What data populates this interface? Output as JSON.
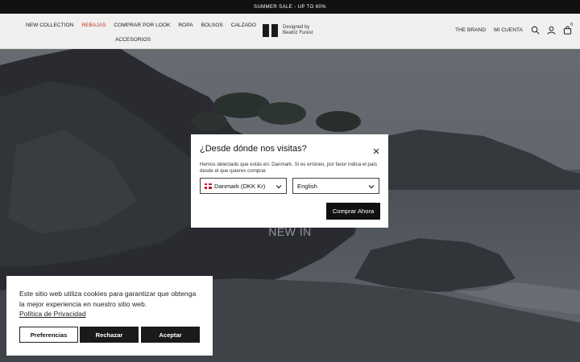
{
  "announcement": "SUMMER SALE - UP TO 60%",
  "nav_left": {
    "row1": [
      "NEW COLLECTION",
      "REBAJAS",
      "COMPRAR POR LOOK",
      "ROPA",
      "BOLSOS",
      "CALZADO"
    ],
    "row2": "ACCESORIOS"
  },
  "logo": {
    "line1": "Designed by",
    "line2": "Beatriz Furest"
  },
  "nav_right": {
    "brand": "THE BRAND",
    "account": "MI CUENTA"
  },
  "cart_count": "0",
  "hero": {
    "title": "NEW IN"
  },
  "country_modal": {
    "title": "¿Desde dónde nos visitas?",
    "text": "Hemos detectado que estás en: Danmark. Si es erróneo, por favor indica el país desde el que quieres comprar.",
    "country_value": "Danmark (DKK Kr)",
    "language_value": "English",
    "submit_label": "Comprar Ahora"
  },
  "cookie_banner": {
    "text": "Este sitio web utiliza cookies para garantizar que obtenga la mejor experiencia en nuestro sitio web.",
    "link": "Política de Privacidad",
    "preferences_label": "Preferencias",
    "reject_label": "Rechazar",
    "accept_label": "Aceptar"
  },
  "colors": {
    "sale": "#c0392b",
    "header_bg": "#f1f0ee",
    "button_dark": "#1a1a1a"
  },
  "icons": [
    "search-icon",
    "user-icon",
    "bag-icon",
    "close-icon",
    "chevron-down-icon",
    "flag-denmark-icon"
  ]
}
